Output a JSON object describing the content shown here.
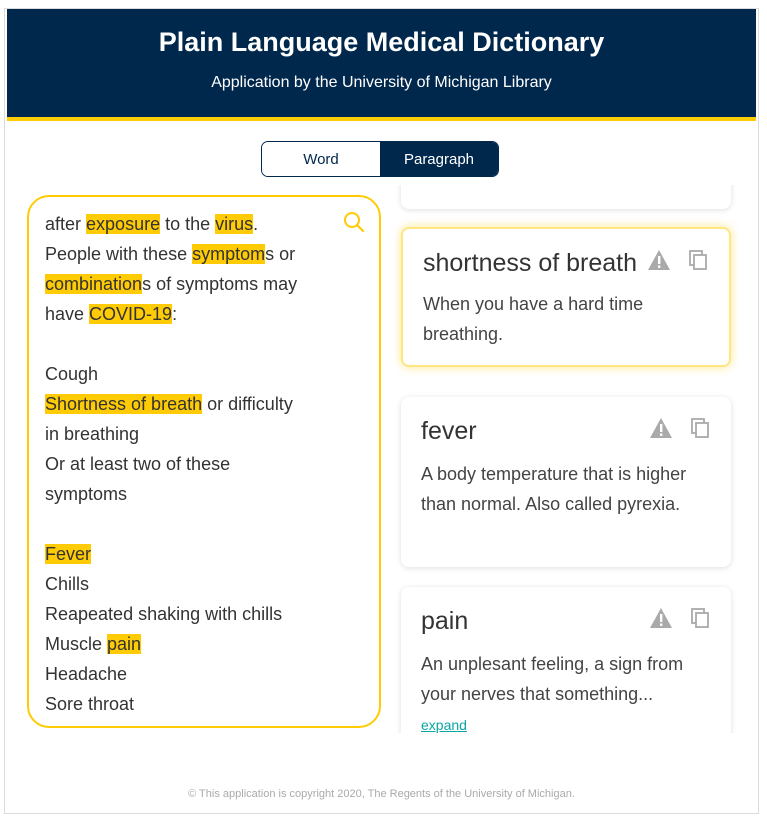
{
  "header": {
    "title": "Plain Language Medical Dictionary",
    "subtitle": "Application by the University of Michigan Library"
  },
  "toggle": {
    "word_label": "Word",
    "paragraph_label": "Paragraph",
    "selected": "Paragraph"
  },
  "text_panel": {
    "lines": [
      [
        {
          "t": "after "
        },
        {
          "t": "exposure",
          "hl": true
        },
        {
          "t": " to the "
        },
        {
          "t": "virus",
          "hl": true
        },
        {
          "t": "."
        }
      ],
      [
        {
          "t": "People with these "
        },
        {
          "t": "symptom",
          "hl": true
        },
        {
          "t": "s or"
        }
      ],
      [
        {
          "t": "combination",
          "hl": true
        },
        {
          "t": "s of symptoms may"
        }
      ],
      [
        {
          "t": "have "
        },
        {
          "t": "COVID-19",
          "hl": true
        },
        {
          "t": ":"
        }
      ],
      [],
      [
        {
          "t": "Cough"
        }
      ],
      [
        {
          "t": "Shortness of breath",
          "hl": true
        },
        {
          "t": " or difficulty"
        }
      ],
      [
        {
          "t": "in breathing"
        }
      ],
      [
        {
          "t": "Or at least two of these"
        }
      ],
      [
        {
          "t": "symptoms"
        }
      ],
      [],
      [
        {
          "t": "Fever",
          "hl": true
        }
      ],
      [
        {
          "t": "Chills"
        }
      ],
      [
        {
          "t": "Reapeated shaking with chills"
        }
      ],
      [
        {
          "t": "Muscle "
        },
        {
          "t": "pain",
          "hl": true
        }
      ],
      [
        {
          "t": "Headache"
        }
      ],
      [
        {
          "t": "Sore throat"
        }
      ]
    ]
  },
  "cards": [
    {
      "term": "shortness of breath",
      "definition": "When you have a hard time breathing.",
      "active": true
    },
    {
      "term": "fever",
      "definition": "A body temperature that is higher than normal. Also called pyrexia."
    },
    {
      "term": "pain",
      "definition": "An unplesant feeling, a sign from your nerves that something...",
      "expand_label": "expand"
    }
  ],
  "footer": {
    "copyright": "© This application is copyright 2020, The Regents of the University of Michigan."
  },
  "colors": {
    "navy": "#00274c",
    "maize": "#ffcb05",
    "link": "#0ba5a5"
  }
}
